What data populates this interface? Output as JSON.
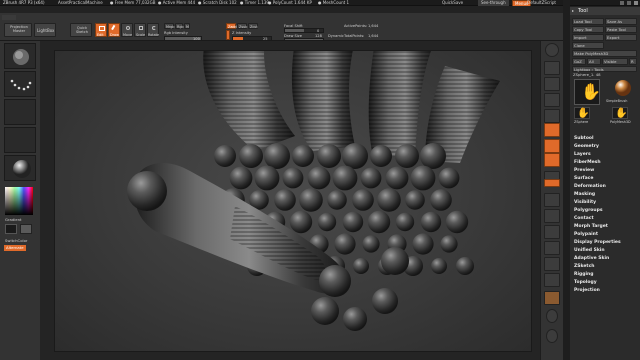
{
  "titlebar": {
    "app_title": "ZBrush 4R7 P3 (x64)",
    "doc_name": "AssetPracticalMachine",
    "mem_free": "● Free Mem 77,032GB",
    "mem_active": "● Active Mem 444",
    "scratch": "● Scratch Disk 102",
    "timer": "● Timer 1.139",
    "polycount": "● PolyCount 1.644 KP",
    "meshcount": "● MeshCount 1",
    "quicksave": "QuickSave",
    "seethrough": "See-through",
    "menus": "Menus",
    "defaultzscript": "DefaultZScript"
  },
  "menubar": {
    "items": [
      "Alpha",
      "Brush",
      "Color",
      "Document",
      "Draw",
      "Edit",
      "File",
      "Layer",
      "Light",
      "Macro",
      "Marker",
      "Material",
      "Movie",
      "Picker",
      "Preferences",
      "Render",
      "Stencil",
      "Stroke",
      "Texture",
      "Tool",
      "Transform",
      "Zplugin",
      "Zscript"
    ]
  },
  "toolbar": {
    "lightbox_label": "Projection Master",
    "lightbox2": "LightBox",
    "quick_sketch": "Quick Sketch",
    "edit": "Edit",
    "draw": "Draw",
    "move": "Move",
    "scale": "Scale",
    "rotate": "Rotate",
    "mrgb": "Mrgb",
    "rgb": "Rgb",
    "m": "M",
    "zadd": "Zadd",
    "zsub": "Zsub",
    "zcut": "Zcut",
    "rgb_intensity_label": "Rgb Intensity",
    "rgb_intensity_value": 100,
    "z_intensity_label": "Z Intensity",
    "z_intensity_value": 25,
    "focal_shift_label": "Focal Shift",
    "focal_shift_value": 0,
    "draw_size_label": "Draw Size",
    "draw_size_value": 128,
    "dynamic_label": "Dynamic",
    "active_points_label": "ActivePoints:",
    "active_points_value": "1,644",
    "total_points_label": "TotalPoints:",
    "total_points_value": "1,644"
  },
  "leftshelf": {
    "gradient_label": "Gradient",
    "switch_color_label": "SwitchColor",
    "alternate_label": "Alternate"
  },
  "tray": {
    "tool_header": "Tool",
    "load_tool": "Load Tool",
    "save_as": "Save As",
    "copy_tool": "Copy Tool",
    "paste_tool": "Paste Tool",
    "import": "Import",
    "export": "Export",
    "clone": "Clone",
    "make_polymesh": "Make PolyMesh3D",
    "goz": "GoZ",
    "all": "All",
    "visible": "Visible",
    "r": "R",
    "lightbox_tools": "Lightbox › Tools",
    "current_tool": "ZSphere_1. 48",
    "tool_thumb_label": "ZSphere",
    "simple_brush": "SimpleBrush",
    "polymesh": "PolyMesh3D",
    "sections": [
      "Subtool",
      "Geometry",
      "Layers",
      "FiberMesh",
      "Preview",
      "Surface",
      "Deformation",
      "Masking",
      "Visibility",
      "Polygroups",
      "Contact",
      "Morph Target",
      "Polypaint",
      "UV Map",
      "Texture Map",
      "Displacement Map",
      "Normal Map",
      "Vector Displacement Map",
      "Display Properties",
      "Unified Skin",
      "Initialize",
      "Import",
      "Export"
    ],
    "visible_sections": [
      "Subtool",
      "Geometry",
      "Layers",
      "FiberMesh",
      "Preview",
      "Surface",
      "Deformation",
      "Masking",
      "Visibility",
      "Polygroups",
      "Contact",
      "Morph Target",
      "Polypaint",
      "Display Properties",
      "Unified Skin",
      "Adaptive Skin",
      "ZSketch",
      "Rigging",
      "Topology",
      "Projection"
    ]
  },
  "colors": {
    "accent": "#e06a2a",
    "panel": "#333333",
    "canvas": "#3d3d3d"
  }
}
